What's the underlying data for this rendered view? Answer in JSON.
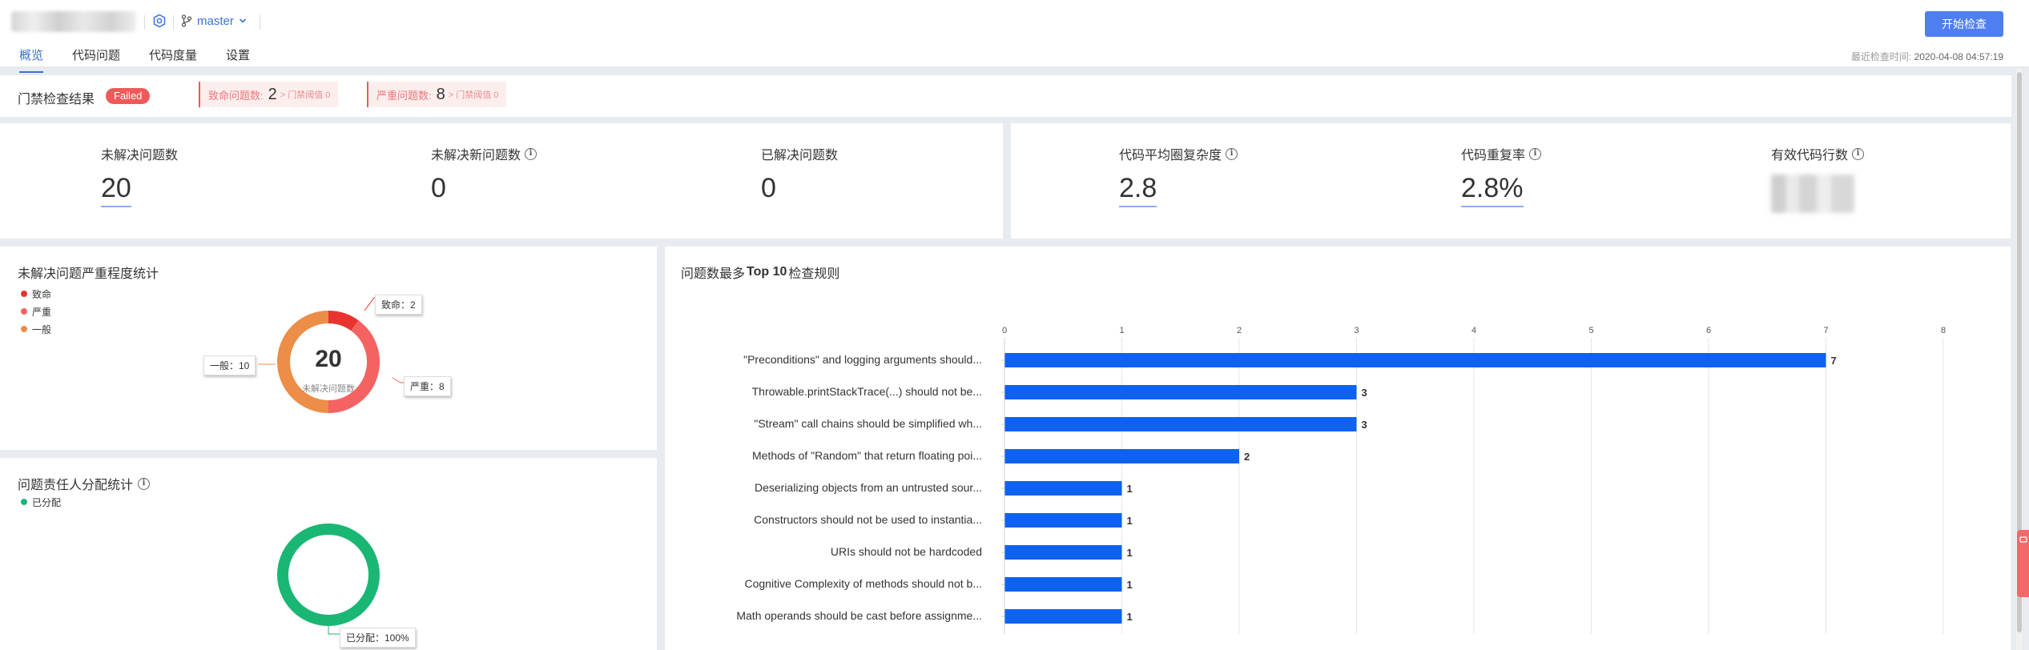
{
  "header": {
    "branch": "master",
    "tabs": [
      {
        "label": "概览",
        "active": true
      },
      {
        "label": "代码问题",
        "active": false
      },
      {
        "label": "代码度量",
        "active": false
      },
      {
        "label": "设置",
        "active": false
      }
    ],
    "start_button": "开始检查",
    "last_check_label": "最近检查时间:",
    "last_check_time": "2020-04-08 04:57:19"
  },
  "gate": {
    "title": "门禁检查结果",
    "status": "Failed",
    "fatal_label": "致命问题数:",
    "fatal_value": "2",
    "fatal_threshold": "> 门禁阈值 0",
    "serious_label": "严重问题数:",
    "serious_value": "8",
    "serious_threshold": "> 门禁阈值 0"
  },
  "stats": {
    "unresolved_label": "未解决问题数",
    "unresolved_value": "20",
    "new_unresolved_label": "未解决新问题数",
    "new_unresolved_value": "0",
    "resolved_label": "已解决问题数",
    "resolved_value": "0",
    "complexity_label": "代码平均圈复杂度",
    "complexity_value": "2.8",
    "dup_label": "代码重复率",
    "dup_value": "2.8%",
    "loc_label": "有效代码行数"
  },
  "severity": {
    "title": "未解决问题严重程度统计",
    "legend": [
      {
        "label": "致命",
        "color": "#e8332f"
      },
      {
        "label": "严重",
        "color": "#f56262"
      },
      {
        "label": "一般",
        "color": "#ec8d48"
      }
    ],
    "center_value": "20",
    "center_label": "未解决问题数",
    "callout_fatal": "致命：2",
    "callout_serious": "严重：8",
    "callout_general": "一般：10",
    "values": {
      "fatal": 2,
      "serious": 8,
      "general": 10
    }
  },
  "assign": {
    "title": "问题责任人分配统计",
    "legend": [
      {
        "label": "已分配",
        "color": "#1ab674"
      }
    ],
    "callout": "已分配：100%",
    "assigned_fraction": 1.0
  },
  "top_rules": {
    "title_prefix": "问题数最多",
    "title_bold": "Top 10",
    "title_suffix": "检查规则",
    "color": "#0d63f0"
  },
  "chart_data": {
    "type": "bar",
    "orientation": "horizontal",
    "categories": [
      "\"Preconditions\" and logging arguments should...",
      "Throwable.printStackTrace(...) should not be...",
      "\"Stream\" call chains should be simplified wh...",
      "Methods of \"Random\" that return floating poi...",
      "Deserializing objects from an untrusted sour...",
      "Constructors should not be used to instantia...",
      "URIs should not be hardcoded",
      "Cognitive Complexity of methods should not b...",
      "Math operands should be cast before assignme..."
    ],
    "values": [
      7,
      3,
      3,
      2,
      1,
      1,
      1,
      1,
      1
    ],
    "xlim": [
      0,
      8
    ],
    "xticks": [
      0,
      1,
      2,
      3,
      4,
      5,
      6,
      7,
      8
    ],
    "grid": true,
    "axis_position": "top",
    "data_labels": true
  }
}
